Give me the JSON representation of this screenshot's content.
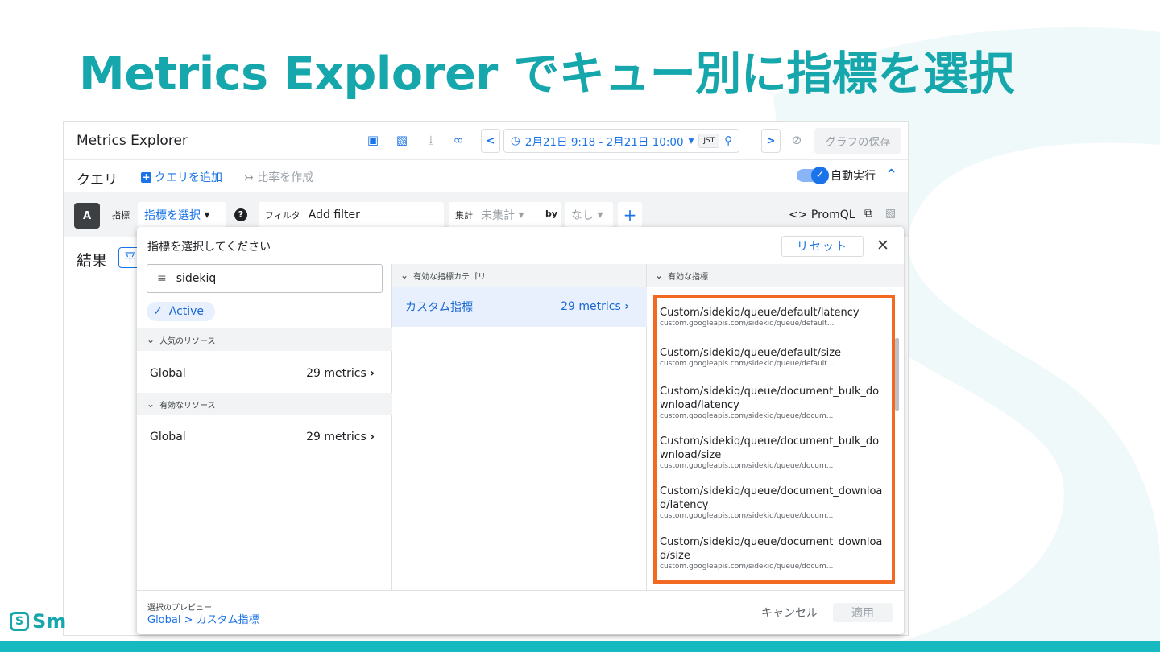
{
  "slide": {
    "title": "Metrics Explorer でキュー別に指標を選択",
    "brand": "Sm",
    "colors": {
      "accent": "#16a7ad",
      "highlight": "#f26a21",
      "link": "#1a73e8"
    }
  },
  "topbar": {
    "app_title": "Metrics Explorer",
    "time_range": "2月21日 9:18 - 2月21日 10:00",
    "timezone": "JST",
    "save_graph": "グラフの保存"
  },
  "querybar": {
    "label": "クエリ",
    "add_query": "クエリを追加",
    "ratio": "比率を作成",
    "autorun": "自動実行"
  },
  "editrow": {
    "query_id": "A",
    "metric_label": "指標",
    "metric_select": "指標を選択",
    "filter_label": "フィルタ",
    "filter_placeholder": "Add filter",
    "agg_label": "集計",
    "agg_value": "未集計",
    "by_label": "by",
    "by_value": "なし",
    "promql": "PromQL"
  },
  "results": {
    "label": "結果",
    "chip": "平"
  },
  "dialog": {
    "title": "指標を選択してください",
    "reset": "リセット",
    "search_value": "sidekiq",
    "active_chip": "Active",
    "popular_resources_hdr": "人気のリソース",
    "active_resources_hdr": "有効なリソース",
    "resources": [
      {
        "name": "Global",
        "count": "29 metrics"
      },
      {
        "name": "Global",
        "count": "29 metrics"
      }
    ],
    "category_hdr": "有効な指標カテゴリ",
    "category": {
      "name": "カスタム指標",
      "count": "29 metrics"
    },
    "metrics_hdr": "有効な指標",
    "metrics": [
      {
        "name": "Custom/sidekiq/queue/default/latency",
        "path": "custom.googleapis.com/sidekiq/queue/default..."
      },
      {
        "name": "Custom/sidekiq/queue/default/size",
        "path": "custom.googleapis.com/sidekiq/queue/default..."
      },
      {
        "name": "Custom/sidekiq/queue/document_bulk_do\n   wnload/latency",
        "path": "custom.googleapis.com/sidekiq/queue/docum..."
      },
      {
        "name": "Custom/sidekiq/queue/document_bulk_do\n   wnload/size",
        "path": "custom.googleapis.com/sidekiq/queue/docum..."
      },
      {
        "name": "Custom/sidekiq/queue/document_downloa\n   d/latency",
        "path": "custom.googleapis.com/sidekiq/queue/docum..."
      },
      {
        "name": "Custom/sidekiq/queue/document_downloa\n   d/size",
        "path": "custom.googleapis.com/sidekiq/queue/docum..."
      }
    ],
    "preview_label": "選択のプレビュー",
    "preview_value": "Global > カスタム指標",
    "cancel": "キャンセル",
    "apply": "適用"
  }
}
